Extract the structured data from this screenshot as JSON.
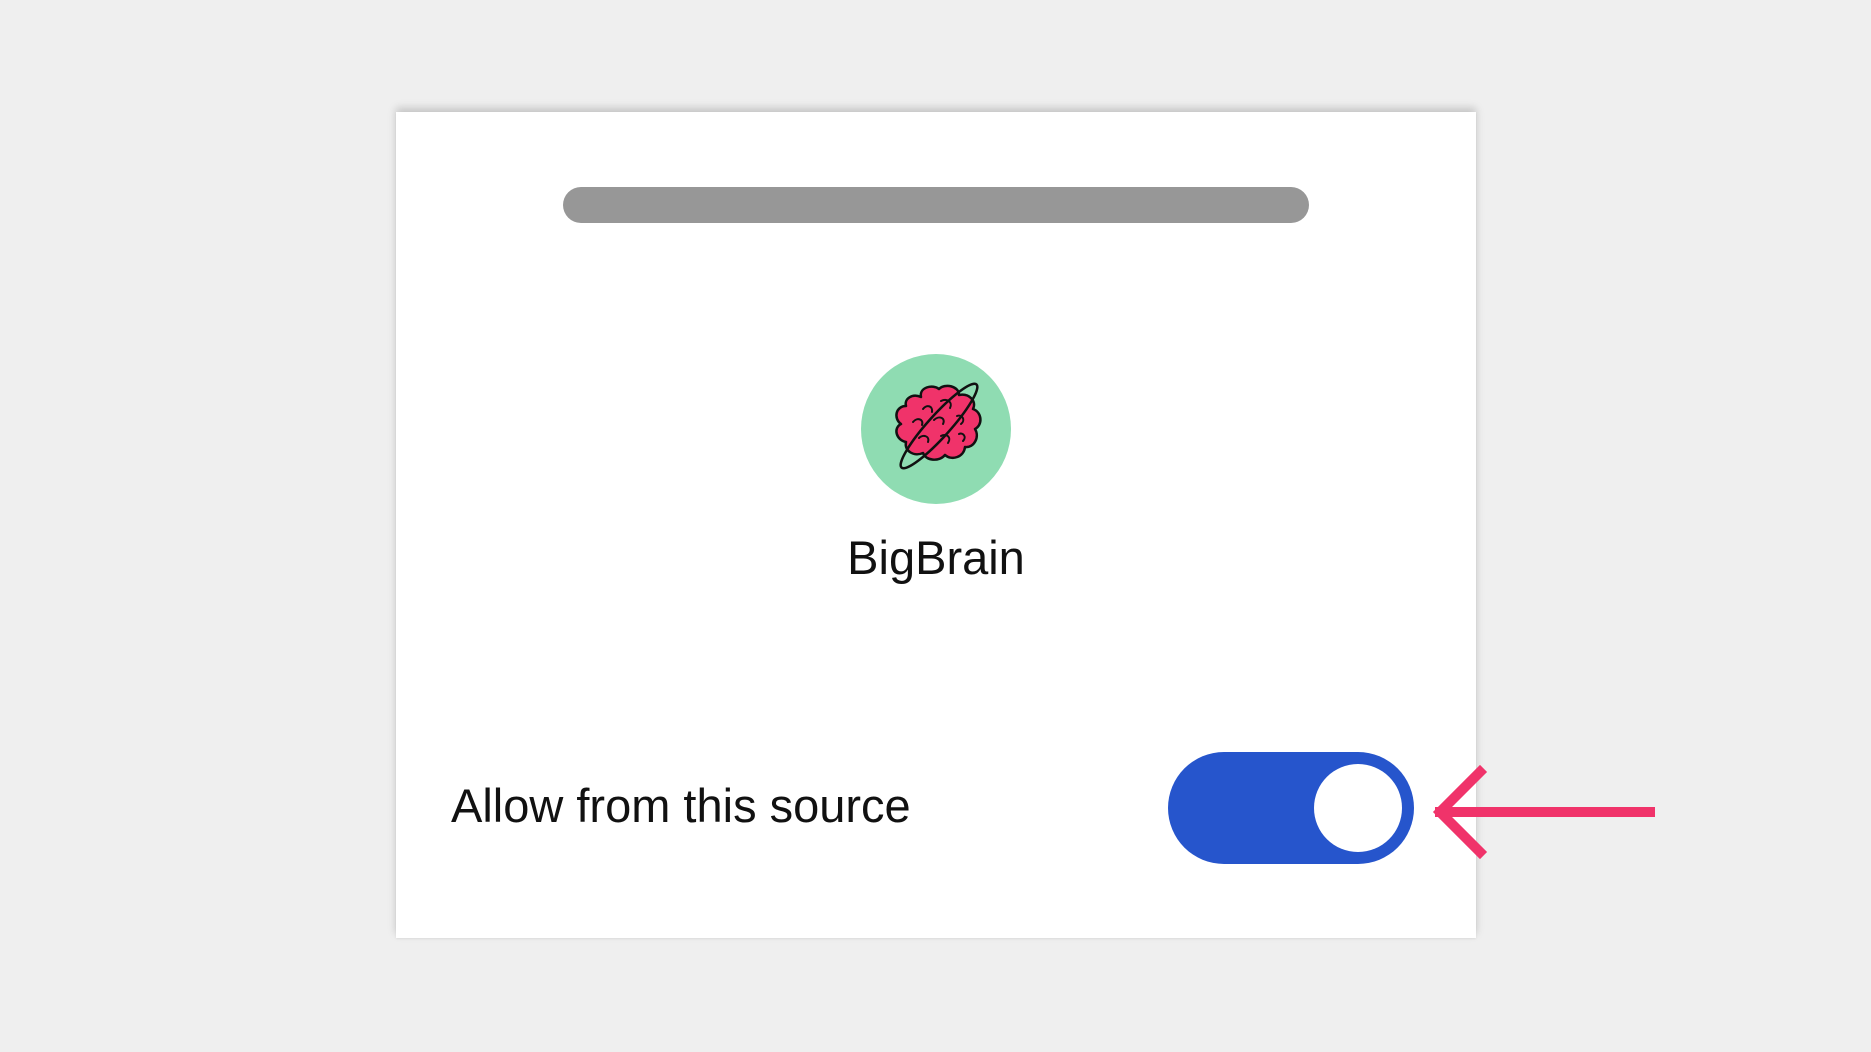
{
  "app": {
    "name": "BigBrain",
    "icon": "brain-planet-icon"
  },
  "setting": {
    "label": "Allow from this source",
    "enabled": true
  },
  "colors": {
    "background": "#efefef",
    "card": "#ffffff",
    "handle": "#979797",
    "icon_bg": "#8fdcb2",
    "brain": "#f0336a",
    "toggle_on": "#2655cc",
    "annotation_arrow": "#f0336a"
  }
}
